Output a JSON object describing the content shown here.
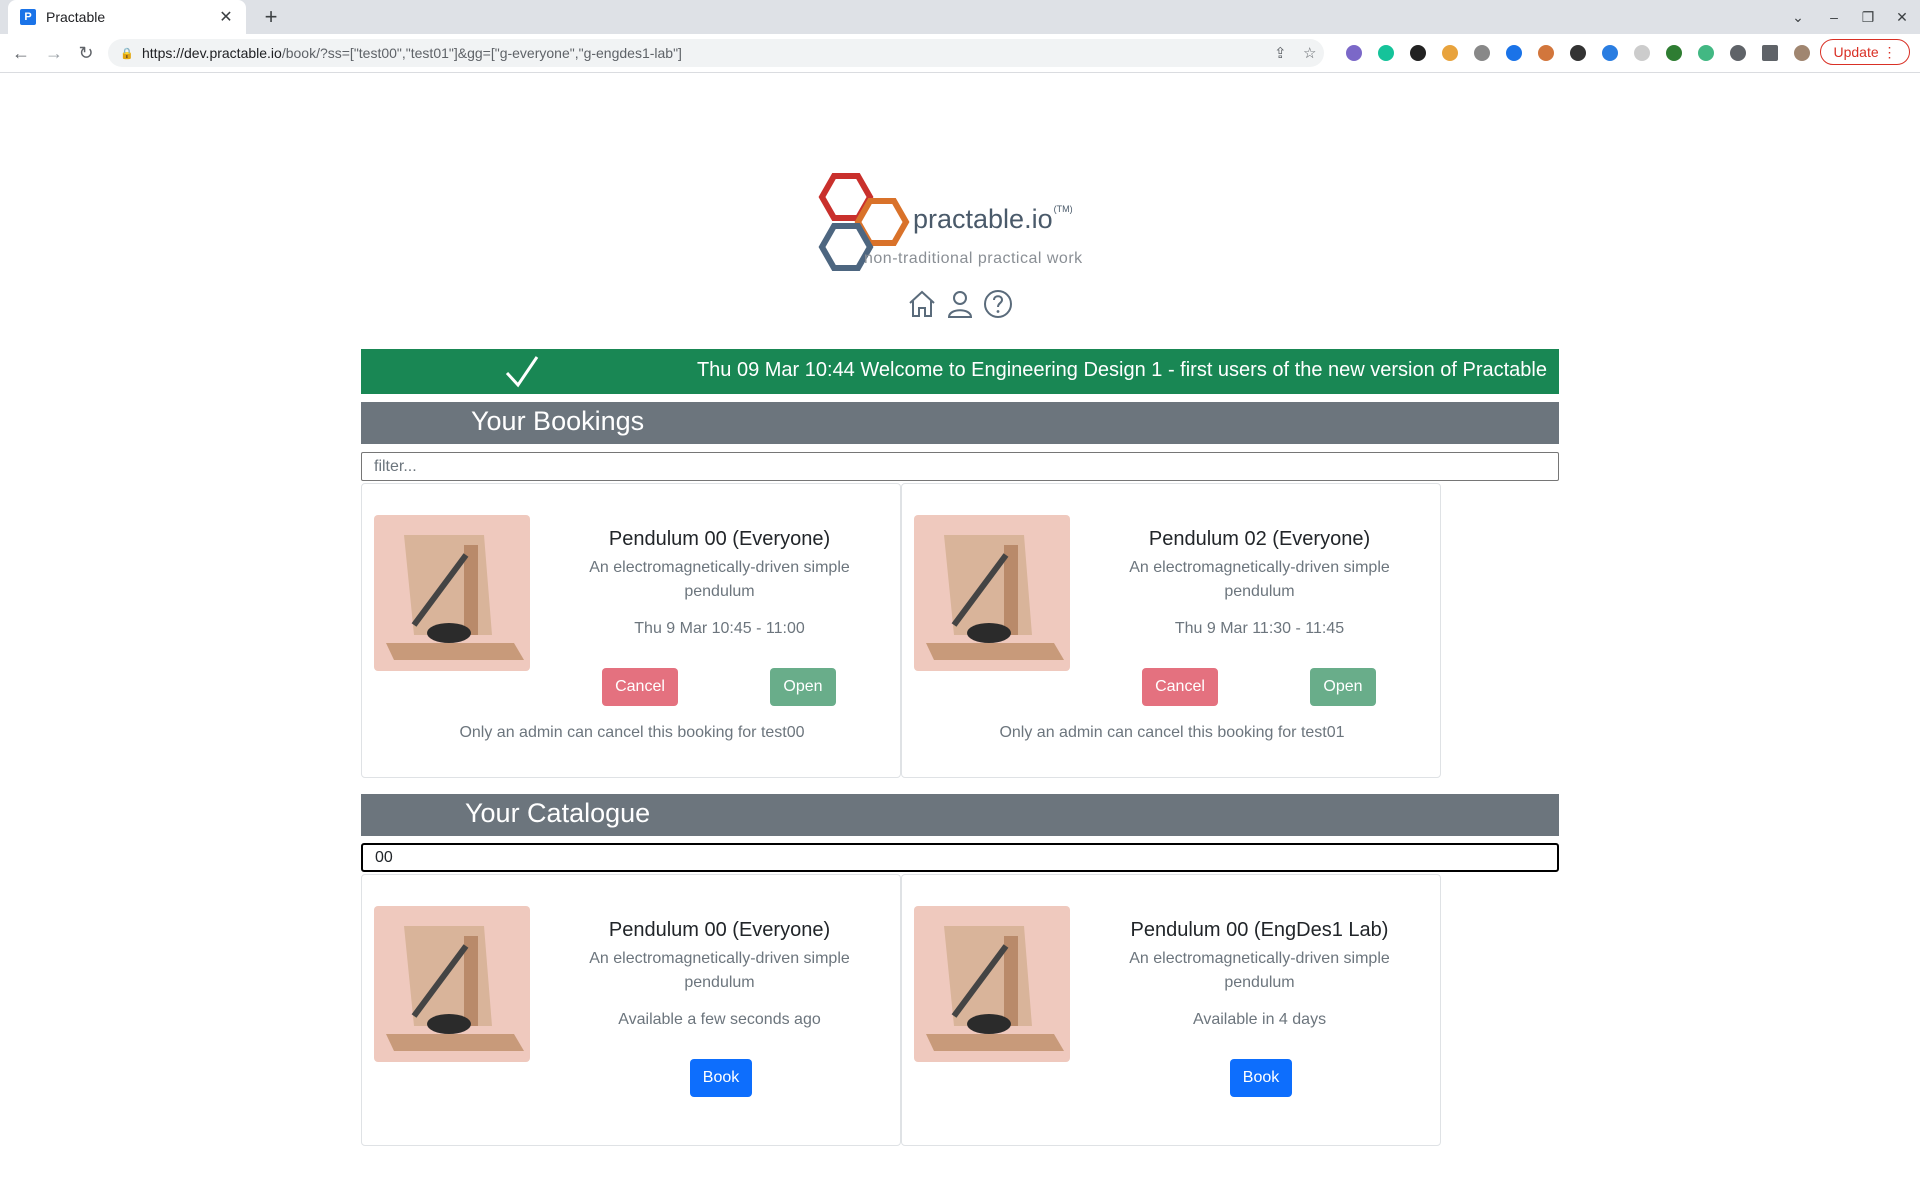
{
  "browser": {
    "tab_title": "Practable",
    "tab_favicon_letter": "P",
    "url_domain": "https://dev.practable.io",
    "url_path": "/book/?ss=[\"test00\",\"test01\"]&gg=[\"g-everyone\",\"g-engdes1-lab\"]",
    "update_label": "Update"
  },
  "brand": {
    "name": "practable.io",
    "tm": "(TM)",
    "tagline": "non-traditional practical work"
  },
  "banner": {
    "message": "Thu 09 Mar 10:44 Welcome to Engineering Design 1 - first users of the new version of Practable"
  },
  "bookings": {
    "heading": "Your Bookings",
    "filter_placeholder": "filter...",
    "items": [
      {
        "title": "Pendulum 00 (Everyone)",
        "description": "An electromagnetically-driven simple pendulum",
        "time": "Thu 9 Mar 10:45 - 11:00",
        "cancel_label": "Cancel",
        "open_label": "Open",
        "note": "Only an admin can cancel this booking for test00"
      },
      {
        "title": "Pendulum 02 (Everyone)",
        "description": "An electromagnetically-driven simple pendulum",
        "time": "Thu 9 Mar 11:30 - 11:45",
        "cancel_label": "Cancel",
        "open_label": "Open",
        "note": "Only an admin can cancel this booking for test01"
      }
    ]
  },
  "catalogue": {
    "heading": "Your Catalogue",
    "filter_value": "00",
    "items": [
      {
        "title": "Pendulum 00 (Everyone)",
        "description": "An electromagnetically-driven simple pendulum",
        "availability": "Available a few seconds ago",
        "book_label": "Book"
      },
      {
        "title": "Pendulum 00 (EngDes1 Lab)",
        "description": "An electromagnetically-driven simple pendulum",
        "availability": "Available in 4 days",
        "book_label": "Book"
      }
    ]
  },
  "colors": {
    "banner": "#198754",
    "section_header": "#6c757d",
    "cancel": "#e4717f",
    "open": "#69ad8a",
    "book": "#0d6efd",
    "logo_red": "#c9302c",
    "logo_orange": "#d9722a",
    "logo_blue": "#4d6680"
  }
}
